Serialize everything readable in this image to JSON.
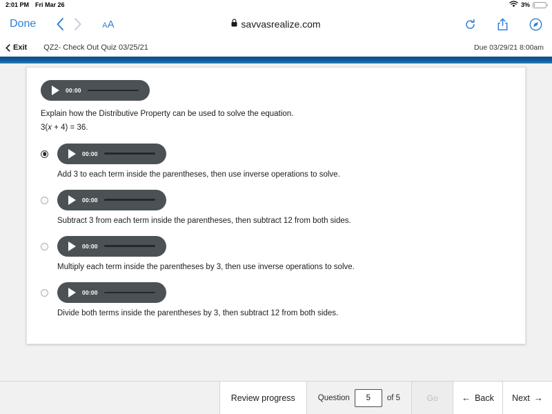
{
  "status_bar": {
    "time": "2:01 PM",
    "date": "Fri Mar 26",
    "battery_percent": "3%",
    "wifi_icon": "wifi-icon",
    "battery_icon": "battery-icon"
  },
  "browser": {
    "done_label": "Done",
    "back_icon": "chevron-left-icon",
    "forward_icon": "chevron-right-icon",
    "text_size_small": "A",
    "text_size_large": "A",
    "lock_icon": "lock-icon",
    "url": "savvasrealize.com",
    "reload_icon": "reload-icon",
    "share_icon": "share-icon",
    "tabs_icon": "compass-icon"
  },
  "app_header": {
    "exit_label": "Exit",
    "exit_icon": "chevron-left-icon",
    "quiz_title": "QZ2- Check Out Quiz 03/25/21",
    "due_text": "Due 03/29/21 8:00am"
  },
  "question": {
    "audio": {
      "time": "00:00",
      "play_icon": "play-icon"
    },
    "prompt": "Explain how the Distributive Property can be used to solve the equation.",
    "equation_prefix": "3(",
    "equation_var": "x",
    "equation_suffix": " + 4) = 36."
  },
  "options": [
    {
      "selected": true,
      "audio_time": "00:00",
      "text": "Add 3 to each term inside the parentheses, then use inverse operations to solve."
    },
    {
      "selected": false,
      "audio_time": "00:00",
      "text": "Subtract 3 from each term inside the parentheses, then subtract 12 from both sides."
    },
    {
      "selected": false,
      "audio_time": "00:00",
      "text": "Multiply each term inside the parentheses by 3, then use inverse operations to solve."
    },
    {
      "selected": false,
      "audio_time": "00:00",
      "text": "Divide both terms inside the parentheses by 3, then subtract 12 from both sides."
    }
  ],
  "bottom_bar": {
    "review_label": "Review progress",
    "question_label": "Question",
    "question_value": "5",
    "of_label": "of 5",
    "go_label": "Go",
    "back_label": "Back",
    "back_icon": "arrow-left-icon",
    "next_label": "Next",
    "next_icon": "arrow-right-icon"
  },
  "colors": {
    "accent_blue": "#2d7fd3",
    "header_bar_blue": "#0d5b9e",
    "audio_pill": "#4b5255",
    "page_bg": "#f1f1f1"
  }
}
